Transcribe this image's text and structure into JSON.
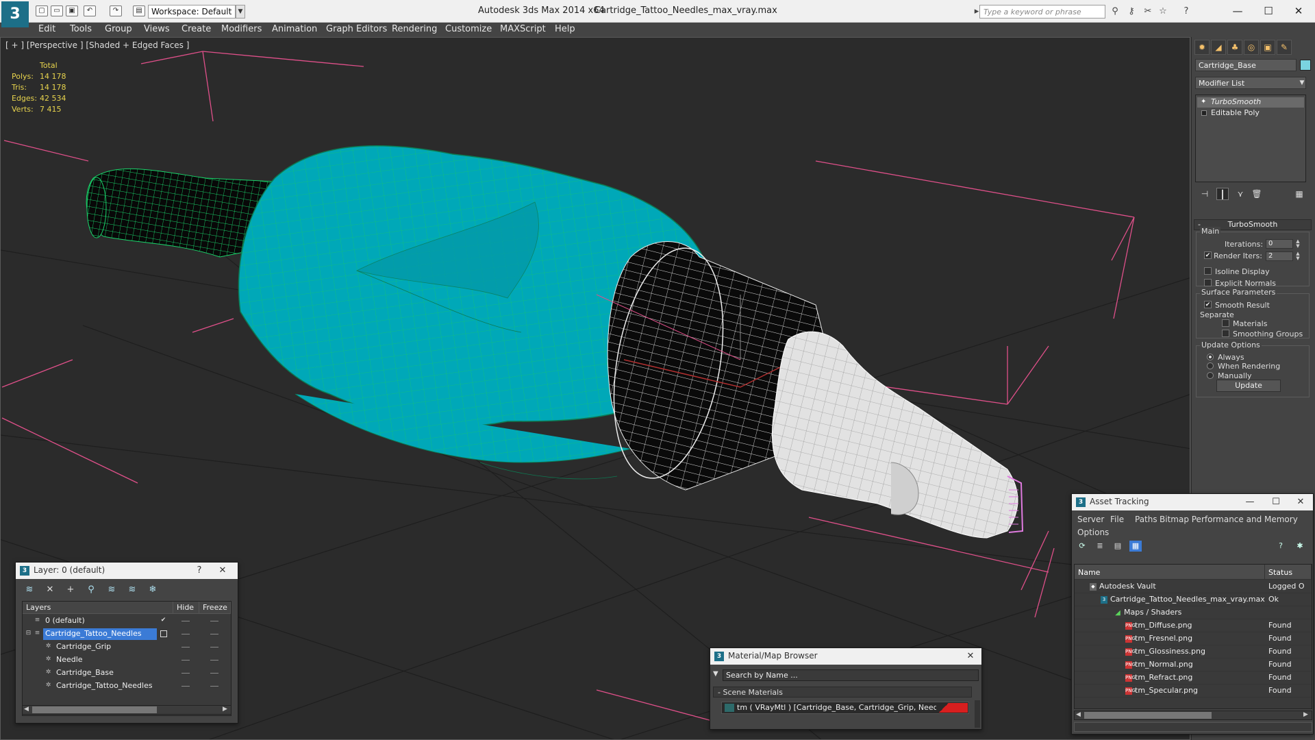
{
  "titlebar": {
    "workspace_label": "Workspace: Default",
    "app_title": "Autodesk 3ds Max  2014 x64",
    "file_title": "Cartridge_Tattoo_Needles_max_vray.max",
    "search_placeholder": "Type a keyword or phrase",
    "logo": "3"
  },
  "menu": [
    "Edit",
    "Tools",
    "Group",
    "Views",
    "Create",
    "Modifiers",
    "Animation",
    "Graph Editors",
    "Rendering",
    "Customize",
    "MAXScript",
    "Help"
  ],
  "viewport": {
    "label": "[ + ] [Perspective ] [Shaded + Edged Faces ]",
    "stats": {
      "total": "Total",
      "rows": [
        {
          "label": "Polys:",
          "value": "14 178"
        },
        {
          "label": "Tris:",
          "value": "14 178"
        },
        {
          "label": "Edges:",
          "value": "42 534"
        },
        {
          "label": "Verts:",
          "value": "7 415"
        }
      ]
    }
  },
  "command_panel": {
    "object_name": "Cartridge_Base",
    "modifier_list": "Modifier List",
    "stack": [
      "TurboSmooth",
      "Editable Poly"
    ],
    "turbosmooth": {
      "title": "TurboSmooth",
      "main": "Main",
      "iterations_label": "Iterations:",
      "iterations_value": "0",
      "render_iters_label": "Render Iters:",
      "render_iters_value": "2",
      "isoline_label": "Isoline Display",
      "explicit_normals_label": "Explicit Normals",
      "surface_params_label": "Surface Parameters",
      "smooth_result_label": "Smooth Result",
      "separate_label": "Separate",
      "materials_label": "Materials",
      "smoothing_groups_label": "Smoothing Groups",
      "update_options_label": "Update Options",
      "always_label": "Always",
      "when_rendering_label": "When Rendering",
      "manually_label": "Manually",
      "update_button": "Update"
    }
  },
  "layer_window": {
    "title": "Layer: 0 (default)",
    "help": "?",
    "columns": [
      "Layers",
      "Hide",
      "Freeze"
    ],
    "rows": [
      {
        "name": "0 (default)",
        "indent": 0
      },
      {
        "name": "Cartridge_Tattoo_Needles",
        "indent": 0
      },
      {
        "name": "Cartridge_Grip",
        "indent": 1
      },
      {
        "name": "Needle",
        "indent": 1
      },
      {
        "name": "Cartridge_Base",
        "indent": 1
      },
      {
        "name": "Cartridge_Tattoo_Needles",
        "indent": 1
      }
    ]
  },
  "material_browser": {
    "title": "Material/Map Browser",
    "search_placeholder": "Search by Name ...",
    "section": "Scene Materials",
    "item": "tm  ( VRayMtl )  [Cartridge_Base, Cartridge_Grip, Needle]"
  },
  "asset_tracking": {
    "title": "Asset Tracking",
    "menu": [
      "Server",
      "File",
      "Paths",
      "Bitmap Performance and Memory",
      "Options"
    ],
    "columns": [
      "Name",
      "Status"
    ],
    "rows": [
      {
        "name": "Autodesk Vault",
        "status": "Logged O",
        "indent": 1
      },
      {
        "name": "Cartridge_Tattoo_Needles_max_vray.max",
        "status": "Ok",
        "indent": 2
      },
      {
        "name": "Maps / Shaders",
        "status": "",
        "indent": 3
      },
      {
        "name": "tm_Diffuse.png",
        "status": "Found",
        "indent": 4
      },
      {
        "name": "tm_Fresnel.png",
        "status": "Found",
        "indent": 4
      },
      {
        "name": "tm_Glossiness.png",
        "status": "Found",
        "indent": 4
      },
      {
        "name": "tm_Normal.png",
        "status": "Found",
        "indent": 4
      },
      {
        "name": "tm_Refract.png",
        "status": "Found",
        "indent": 4
      },
      {
        "name": "tm_Specular.png",
        "status": "Found",
        "indent": 4
      }
    ]
  },
  "colors": {
    "mesh_cyan": "#00a8b8",
    "mesh_wire": "#1ad36a",
    "selection_blue": "#3b7bd6",
    "stats_yellow": "#e8d44d"
  }
}
